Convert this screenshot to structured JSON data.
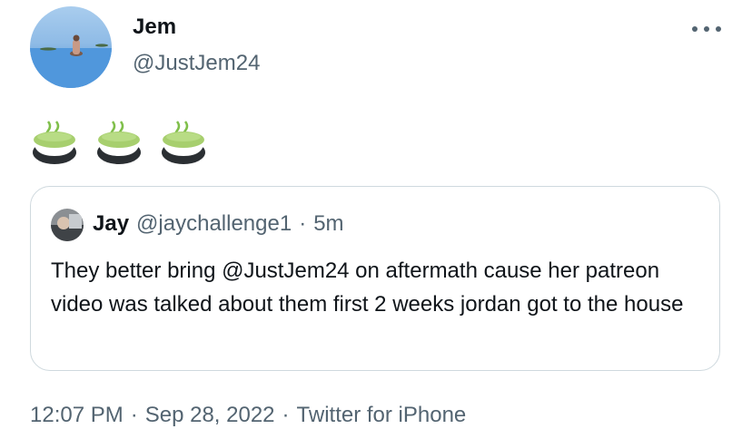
{
  "tweet": {
    "author_name": "Jem",
    "author_handle": "@JustJem24",
    "emojis": [
      "green-soup-bowl",
      "green-soup-bowl",
      "green-soup-bowl"
    ],
    "time": "12:07 PM",
    "date": "Sep 28, 2022",
    "source": "Twitter for iPhone",
    "separator": "·"
  },
  "quoted": {
    "author_name": "Jay",
    "author_handle": "@jaychallenge1",
    "separator": "·",
    "time": "5m",
    "text": "They better bring @JustJem24 on aftermath cause her patreon video was talked about them first 2 weeks jordan got to the house"
  },
  "icons": {
    "more": "more-horizontal-icon"
  },
  "colors": {
    "text": "#0f1419",
    "muted": "#536471",
    "border": "#cfd9de",
    "soup": "#a7cf6e"
  }
}
